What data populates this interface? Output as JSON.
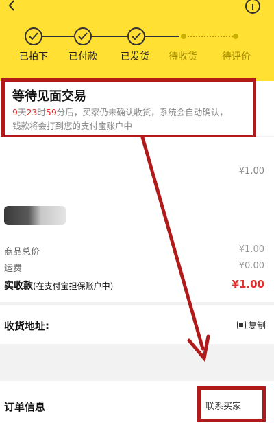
{
  "steps": [
    {
      "label": "已拍下",
      "state": "done"
    },
    {
      "label": "已付款",
      "state": "done"
    },
    {
      "label": "已发货",
      "state": "done"
    },
    {
      "label": "待收货",
      "state": "todo"
    },
    {
      "label": "待评价",
      "state": "todo"
    }
  ],
  "status": {
    "title": "等待见面交易",
    "countdown_days": "9",
    "unit_day": "天",
    "countdown_hours": "23",
    "unit_hour": "时",
    "countdown_minutes": "59",
    "desc_line1": "分后，买家仍未确认收货，系统会自动确认，",
    "desc_line2": "钱款将会打到您的支付宝账户中"
  },
  "item": {
    "price": "¥1.00"
  },
  "summary": {
    "goods_total_label": "商品总价",
    "goods_total_value": "¥1.00",
    "shipping_label": "运费",
    "shipping_value": "¥0.00",
    "paid_label": "实收款",
    "paid_note": "(在支付宝担保账户中)",
    "paid_value": "¥1.00"
  },
  "address": {
    "label": "收货地址:",
    "copy_label": "复制"
  },
  "order": {
    "label": "订单信息",
    "contact_buyer_label": "联系买家"
  },
  "colors": {
    "header_yellow": "#ffe033",
    "annotation_red": "#b11a1a",
    "price_red": "#e03030"
  }
}
